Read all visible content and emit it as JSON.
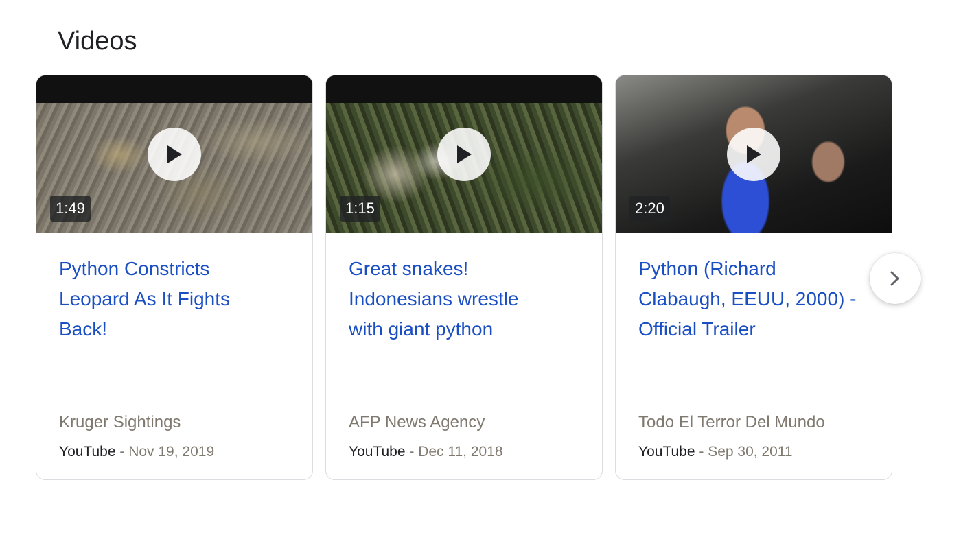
{
  "section": {
    "title": "Videos"
  },
  "videos": [
    {
      "title": "Python Constricts\nLeopard As It Fights\nBack!",
      "duration": "1:49",
      "channel": "Kruger Sightings",
      "source": "YouTube",
      "separator": " - ",
      "date": "Nov 19, 2019"
    },
    {
      "title": "Great snakes!\nIndonesians wrestle\nwith giant python",
      "duration": "1:15",
      "channel": "AFP News Agency",
      "source": "YouTube",
      "separator": " - ",
      "date": "Dec 11, 2018"
    },
    {
      "title": "Python (Richard\nClabaugh, EEUU, 2000) -\nOfficial Trailer",
      "duration": "2:20",
      "channel": "Todo El Terror Del Mundo",
      "source": "YouTube",
      "separator": " - ",
      "date": "Sep 30, 2011"
    }
  ],
  "icons": {
    "play": "play-icon",
    "next": "chevron-right-icon"
  },
  "colors": {
    "title_link": "#1a4fc4",
    "muted": "#80796f",
    "border": "#dadce0"
  }
}
